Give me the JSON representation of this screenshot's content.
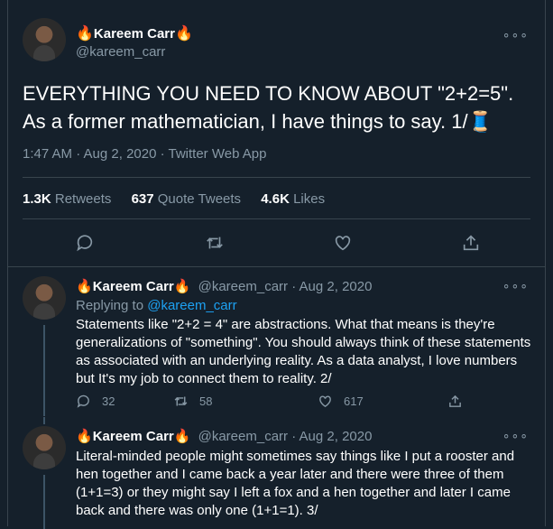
{
  "main_tweet": {
    "name": "Kareem Carr",
    "name_emoji_before": "🔥",
    "name_emoji_after": "🔥",
    "handle": "@kareem_carr",
    "text": "EVERYTHING YOU NEED TO KNOW ABOUT \"2+2=5\". As a former mathematician, I have things to say.  1/",
    "text_emoji": "🧵",
    "meta": "1:47 AM · Aug 2, 2020 · Twitter Web App",
    "stats": {
      "retweets_count": "1.3K",
      "retweets_label": "Retweets",
      "quotes_count": "637",
      "quotes_label": "Quote Tweets",
      "likes_count": "4.6K",
      "likes_label": "Likes"
    },
    "more_glyph": "∘∘∘"
  },
  "replies": [
    {
      "name": "Kareem Carr",
      "emoji": "🔥",
      "handle_date": "@kareem_carr · Aug 2, 2020",
      "replying_prefix": "Replying to ",
      "replying_to": "@kareem_carr",
      "text": "Statements like \"2+2 = 4\" are abstractions. What that means is they're generalizations of \"something\". You should always think of these statements as associated with an underlying reality. As a data analyst, I love numbers but It's my job to connect them to reality. 2/",
      "replies": "32",
      "retweets": "58",
      "likes": "617",
      "more_glyph": "∘∘∘"
    },
    {
      "name": "Kareem Carr",
      "emoji": "🔥",
      "handle_date": "@kareem_carr · Aug 2, 2020",
      "text": "Literal-minded people might sometimes say things like I put a rooster and hen together and I came back a year later and there were three of them (1+1=3) or they might say I left a fox and a hen together and later I came back and there was only one (1+1=1).  3/",
      "more_glyph": "∘∘∘"
    }
  ],
  "colors": {
    "background": "#15202b",
    "text": "#ffffff",
    "secondary": "#8899a6",
    "link": "#1da1f2",
    "border": "#38444d"
  }
}
